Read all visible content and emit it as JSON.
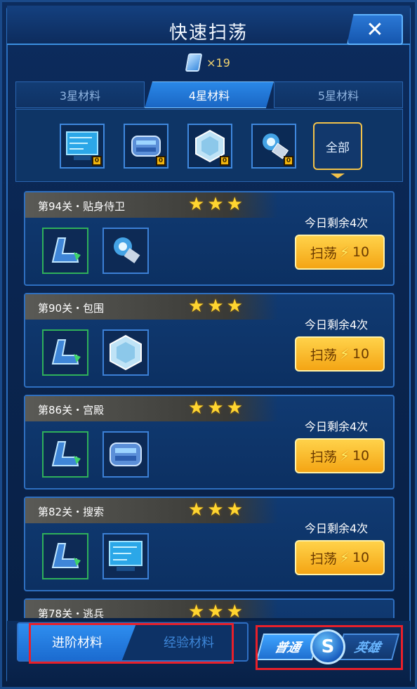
{
  "window": {
    "title": "快速扫荡",
    "close_label": "✕"
  },
  "ticket": {
    "count_label": "×19"
  },
  "tabs": [
    {
      "label": "3星材料",
      "active": false
    },
    {
      "label": "4星材料",
      "active": true
    },
    {
      "label": "5星材料",
      "active": false
    }
  ],
  "materials": {
    "items": [
      {
        "icon": "hologram-screen-icon",
        "count": "0"
      },
      {
        "icon": "engine-module-icon",
        "count": "0"
      },
      {
        "icon": "crystal-hexagon-icon",
        "count": "0"
      },
      {
        "icon": "energy-core-icon",
        "count": "0"
      }
    ],
    "all_label": "全部"
  },
  "stages": [
    {
      "name": "第94关・贴身侍卫",
      "stars": 3,
      "remain": "今日剩余4次",
      "button": "扫荡",
      "cost": "10",
      "drops": [
        "green-chair-icon",
        "energy-core-icon"
      ]
    },
    {
      "name": "第90关・包围",
      "stars": 3,
      "remain": "今日剩余4次",
      "button": "扫荡",
      "cost": "10",
      "drops": [
        "green-chair-icon",
        "crystal-hexagon-icon"
      ]
    },
    {
      "name": "第86关・宫殿",
      "stars": 3,
      "remain": "今日剩余4次",
      "button": "扫荡",
      "cost": "10",
      "drops": [
        "green-chair-icon",
        "engine-module-icon"
      ]
    },
    {
      "name": "第82关・搜索",
      "stars": 3,
      "remain": "今日剩余4次",
      "button": "扫荡",
      "cost": "10",
      "drops": [
        "green-chair-icon",
        "hologram-screen-icon"
      ]
    },
    {
      "name": "第78关・逃兵",
      "stars": 3,
      "remain": "",
      "button": "",
      "cost": "",
      "drops": []
    }
  ],
  "bottom": {
    "advance_label": "进阶材料",
    "exp_label": "经验材料",
    "mode_normal": "普通",
    "mode_hero": "英雄"
  },
  "colors": {
    "accent_blue": "#2f8ff0",
    "button_gold": "#f4a514",
    "star_gold": "#ffd530",
    "highlight_red": "#e8202a"
  }
}
